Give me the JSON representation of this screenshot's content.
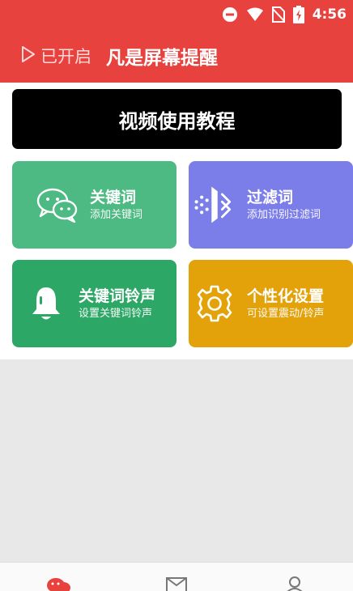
{
  "status_bar": {
    "time": "4:56"
  },
  "header": {
    "toggle_label": "已开启",
    "title": "凡是屏幕提醒"
  },
  "main": {
    "video_button": "视频使用教程",
    "tiles": [
      {
        "title": "关键词",
        "subtitle": "添加关键词",
        "color": "#4cba82",
        "icon": "wechat-icon"
      },
      {
        "title": "过滤词",
        "subtitle": "添加识别过滤词",
        "color": "#7b7ee9",
        "icon": "filter-icon"
      },
      {
        "title": "关键词铃声",
        "subtitle": "设置关键词铃声",
        "color": "#2da765",
        "icon": "bell-icon"
      },
      {
        "title": "个性化设置",
        "subtitle": "可设置震动/铃声",
        "color": "#e3a20a",
        "icon": "gear-icon"
      }
    ]
  },
  "bottom_nav": {
    "items": [
      "home-icon",
      "message-icon",
      "profile-icon"
    ],
    "active_color": "#e8423f"
  },
  "colors": {
    "header": "#e8423f",
    "background": "#e8e8e8"
  }
}
